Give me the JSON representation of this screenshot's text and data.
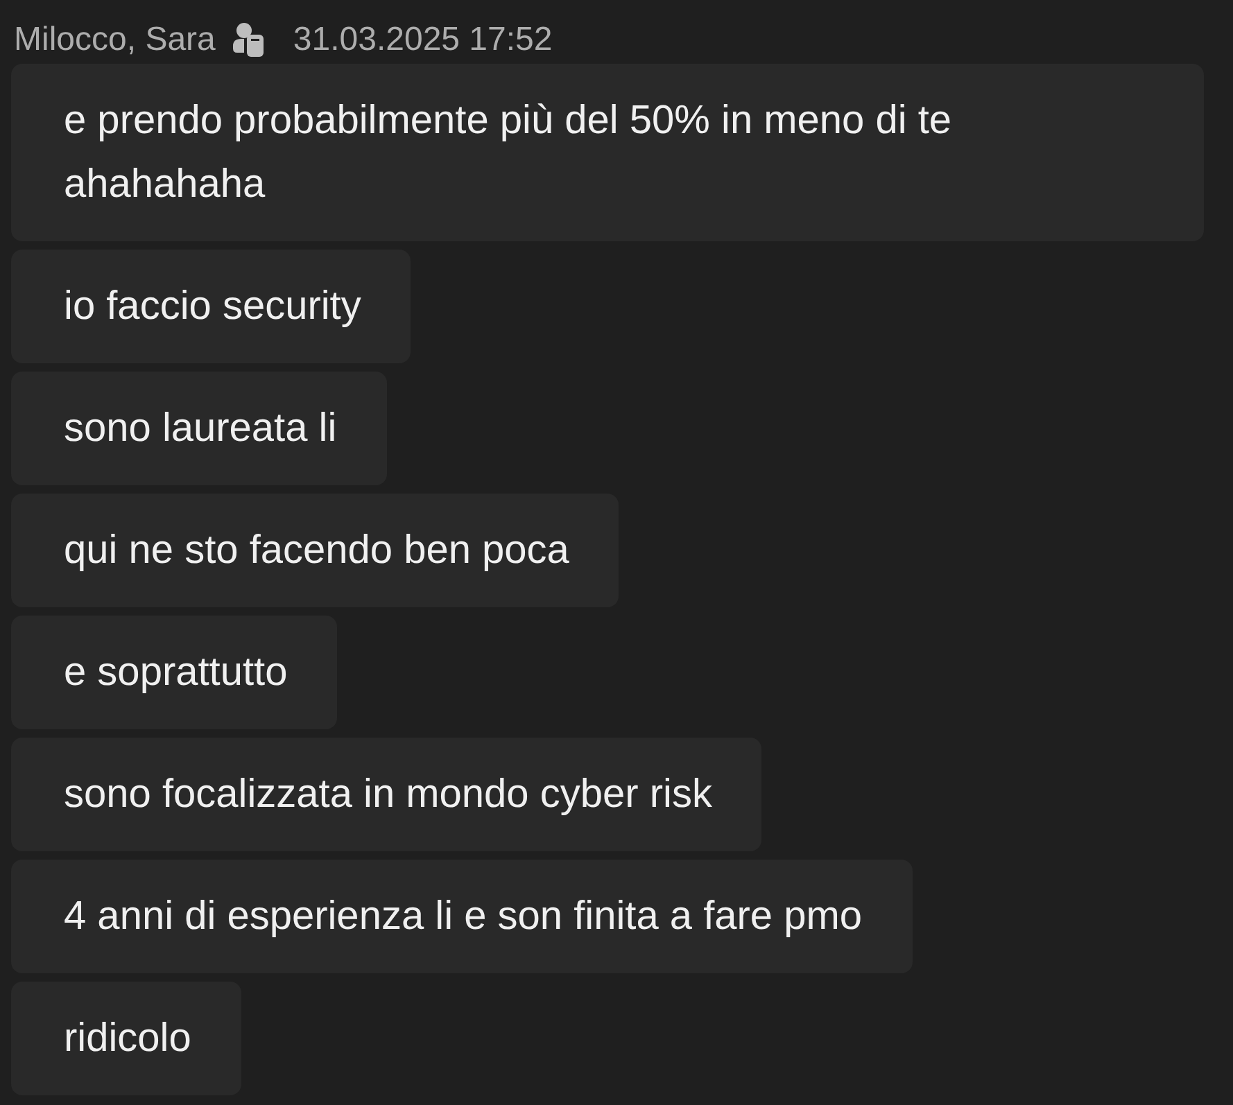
{
  "header": {
    "sender": "Milocco, Sara",
    "timestamp": "31.03.2025 17:52"
  },
  "messages": [
    {
      "text": "e prendo probabilmente più del 50% in meno di te ahahahaha"
    },
    {
      "text": "io faccio security"
    },
    {
      "text": "sono laureata li"
    },
    {
      "text": "qui ne sto facendo ben poca"
    },
    {
      "text": "e soprattutto"
    },
    {
      "text": "sono focalizzata in mondo cyber risk"
    },
    {
      "text": "4 anni di esperienza li e son finita a fare pmo"
    },
    {
      "text": "ridicolo"
    }
  ]
}
